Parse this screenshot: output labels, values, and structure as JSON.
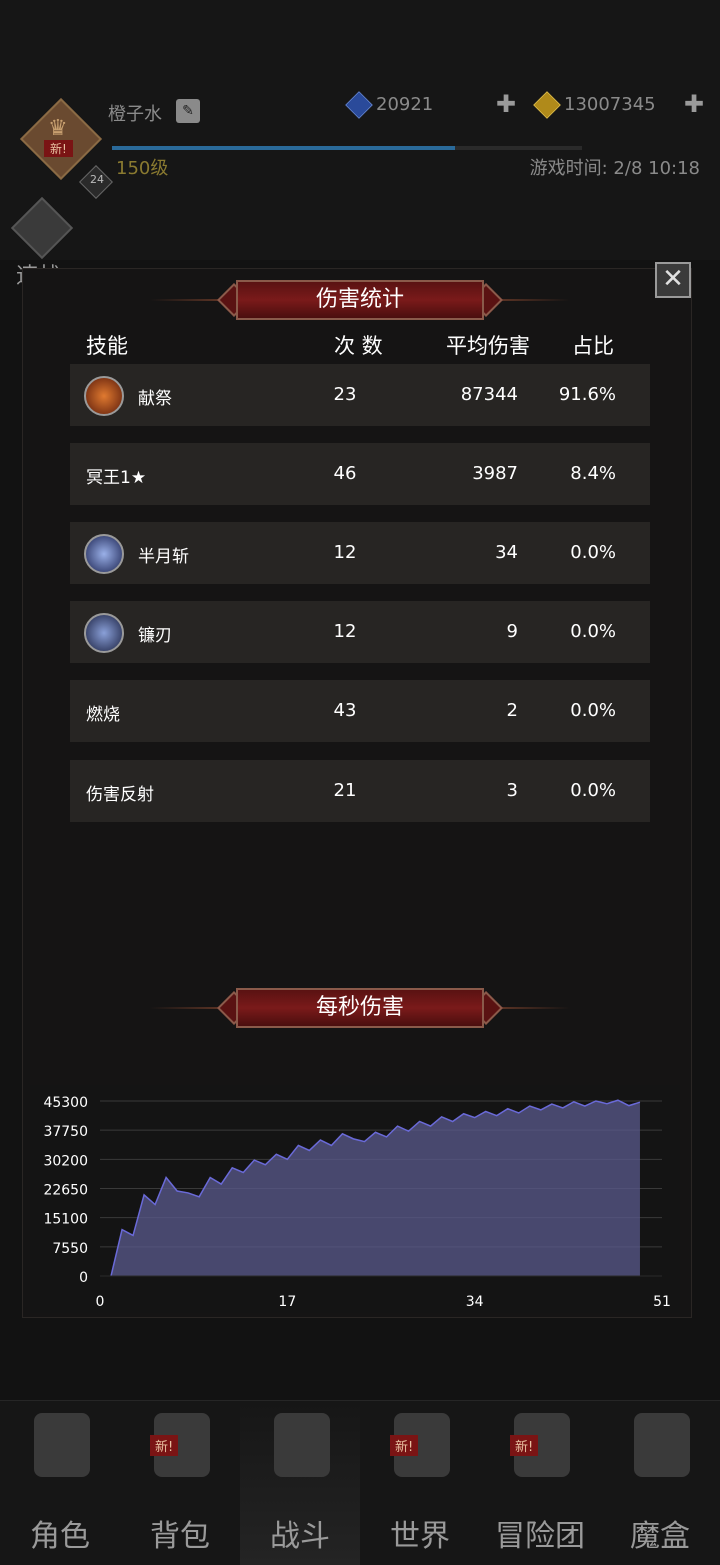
{
  "header": {
    "player_name": "橙子水",
    "avatar_badge": "新!",
    "avatar_sub_level": "24",
    "level": "150级",
    "resources": [
      {
        "icon": "blue-gem-icon",
        "value": "20921"
      },
      {
        "icon": "gold-coin-icon",
        "value": "13007345"
      }
    ],
    "game_time": "游戏时间: 2/8 10:18",
    "quick_battle": "速战"
  },
  "damage_stats": {
    "title": "伤害统计",
    "columns": {
      "skill": "技能",
      "count": "次 数",
      "avg": "平均伤害",
      "pct": "占比"
    },
    "rows": [
      {
        "name": "献祭",
        "count": "23",
        "avg": "87344",
        "pct": "91.6%",
        "icon": "sacrifice-icon"
      },
      {
        "name": "冥王1★",
        "count": "46",
        "avg": "3987",
        "pct": "8.4%",
        "icon": ""
      },
      {
        "name": "半月斩",
        "count": "12",
        "avg": "34",
        "pct": "0.0%",
        "icon": "half-moon-slash-icon"
      },
      {
        "name": "镰刃",
        "count": "12",
        "avg": "9",
        "pct": "0.0%",
        "icon": "scythe-blade-icon"
      },
      {
        "name": "燃烧",
        "count": "43",
        "avg": "2",
        "pct": "0.0%",
        "icon": ""
      },
      {
        "name": "伤害反射",
        "count": "21",
        "avg": "3",
        "pct": "0.0%",
        "icon": ""
      }
    ]
  },
  "dps_section": {
    "title": "每秒伤害"
  },
  "chart_data": {
    "type": "area",
    "title": "",
    "xlabel": "",
    "ylabel": "",
    "x_ticks": [
      0,
      17,
      34,
      51
    ],
    "y_ticks": [
      0,
      7550,
      15100,
      22650,
      30200,
      37750,
      45300
    ],
    "xlim": [
      0,
      51
    ],
    "ylim": [
      0,
      45300
    ],
    "grid": true,
    "color": "#5a5a8c",
    "series": [
      {
        "x": [
          1,
          2,
          3,
          4,
          5,
          6,
          7,
          8,
          9,
          10,
          11,
          12,
          13,
          14,
          15,
          16,
          17,
          18,
          19,
          20,
          21,
          22,
          23,
          24,
          25,
          26,
          27,
          28,
          29,
          30,
          31,
          32,
          33,
          34,
          35,
          36,
          37,
          38,
          39,
          40,
          41,
          42,
          43,
          44,
          45,
          46,
          47,
          48,
          49
        ],
        "values": [
          0,
          12000,
          10500,
          21000,
          18500,
          25500,
          22000,
          21500,
          20500,
          25500,
          23800,
          28000,
          26800,
          30000,
          28800,
          31500,
          30200,
          33800,
          32500,
          35200,
          33800,
          36800,
          35500,
          34800,
          37200,
          36000,
          38800,
          37500,
          40000,
          38800,
          41200,
          40000,
          42000,
          41000,
          42600,
          41500,
          43300,
          42200,
          44000,
          43000,
          44500,
          43500,
          45100,
          44000,
          45300,
          44600,
          45500,
          44100,
          45000
        ]
      }
    ]
  },
  "nav": {
    "items": [
      {
        "label": "角色",
        "icon": "helmet-icon",
        "badge": ""
      },
      {
        "label": "背包",
        "icon": "backpack-icon",
        "badge": "新!"
      },
      {
        "label": "战斗",
        "icon": "sword-shield-icon",
        "badge": ""
      },
      {
        "label": "世界",
        "icon": "scroll-map-icon",
        "badge": "新!"
      },
      {
        "label": "冒险团",
        "icon": "castle-icon",
        "badge": "新!"
      },
      {
        "label": "魔盒",
        "icon": "magic-cube-icon",
        "badge": ""
      }
    ],
    "active": "战斗"
  }
}
